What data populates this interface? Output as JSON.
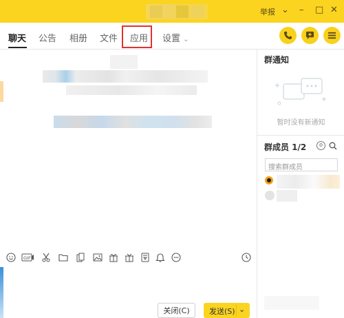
{
  "titlebar": {
    "report_label": "举报",
    "controls": {
      "menu": "⌄",
      "minimize": "–",
      "maximize": "□",
      "close": "✕"
    }
  },
  "tabs": [
    {
      "label": "聊天",
      "active": true
    },
    {
      "label": "公告"
    },
    {
      "label": "相册"
    },
    {
      "label": "文件"
    },
    {
      "label": "应用",
      "highlighted": true
    },
    {
      "label": "设置",
      "has_dropdown": true
    }
  ],
  "header_buttons": [
    {
      "name": "phone-icon"
    },
    {
      "name": "add-chat-icon"
    },
    {
      "name": "more-icon"
    }
  ],
  "sidebar": {
    "notice_title": "群通知",
    "notice_empty": "暂时没有新通知",
    "members_title": "群成员 1/2",
    "search_placeholder": "搜索群成员"
  },
  "toolbar_icons": [
    "emoji-icon",
    "gif-icon",
    "scissors-icon",
    "folder-icon",
    "doc-icon",
    "image-icon",
    "gift-icon",
    "shake-icon",
    "bell-icon",
    "more-icon",
    "history-clock-icon"
  ],
  "buttons": {
    "close": "关闭(C)",
    "send": "发送(S)"
  },
  "colors": {
    "brand": "#fbd420",
    "highlight": "#e0322f"
  }
}
